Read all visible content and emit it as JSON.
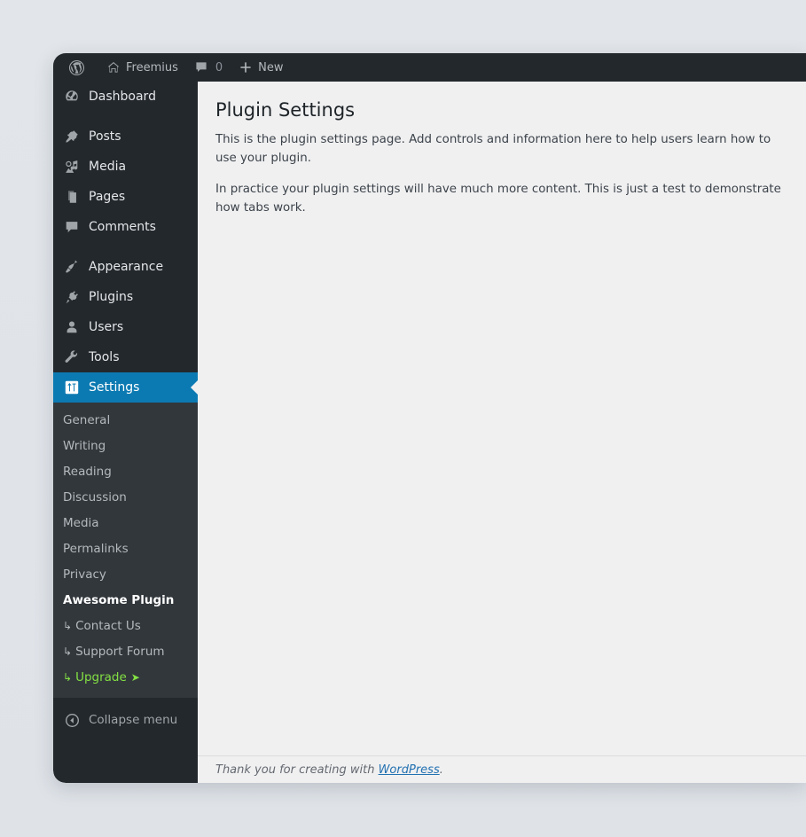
{
  "adminbar": {
    "wp_logo_icon": "wordpress-logo-icon",
    "site_icon": "home-icon",
    "site_name": "Freemius",
    "comments_icon": "comment-bubble-icon",
    "comments_count": "0",
    "new_icon": "plus-icon",
    "new_label": "New"
  },
  "sidebar": {
    "menu": [
      {
        "label": "Dashboard",
        "icon": "dashboard-gauge-icon",
        "current": false,
        "sep_after": true
      },
      {
        "label": "Posts",
        "icon": "pin-icon",
        "current": false,
        "sep_after": false
      },
      {
        "label": "Media",
        "icon": "media-icon",
        "current": false,
        "sep_after": false
      },
      {
        "label": "Pages",
        "icon": "pages-icon",
        "current": false,
        "sep_after": false
      },
      {
        "label": "Comments",
        "icon": "comment-bubble-icon",
        "current": false,
        "sep_after": true
      },
      {
        "label": "Appearance",
        "icon": "paintbrush-icon",
        "current": false,
        "sep_after": false
      },
      {
        "label": "Plugins",
        "icon": "plug-icon",
        "current": false,
        "sep_after": false
      },
      {
        "label": "Users",
        "icon": "user-icon",
        "current": false,
        "sep_after": false
      },
      {
        "label": "Tools",
        "icon": "wrench-icon",
        "current": false,
        "sep_after": false
      },
      {
        "label": "Settings",
        "icon": "settings-sliders-icon",
        "current": true,
        "sep_after": false
      }
    ],
    "submenu": [
      {
        "label": "General",
        "type": "link"
      },
      {
        "label": "Writing",
        "type": "link"
      },
      {
        "label": "Reading",
        "type": "link"
      },
      {
        "label": "Discussion",
        "type": "link"
      },
      {
        "label": "Media",
        "type": "link"
      },
      {
        "label": "Permalinks",
        "type": "link"
      },
      {
        "label": "Privacy",
        "type": "link"
      },
      {
        "label": "Awesome Plugin",
        "type": "head"
      },
      {
        "label": "Contact Us",
        "type": "nested",
        "lead": "↳"
      },
      {
        "label": "Support Forum",
        "type": "nested",
        "lead": "↳"
      },
      {
        "label": "Upgrade",
        "type": "upgrade",
        "lead": "↳",
        "arrow": "➤"
      }
    ],
    "collapse": {
      "label": "Collapse menu",
      "icon": "collapse-arrow-left-icon"
    },
    "colors": {
      "menu_bg": "#23282d",
      "submenu_bg": "#32373c",
      "current_bg": "#0c7ab2",
      "upgrade_green": "#83e043"
    }
  },
  "content": {
    "title": "Plugin Settings",
    "paragraph_1": "This is the plugin settings page. Add controls and information here to help users learn how to use your plugin.",
    "paragraph_2": "In practice your plugin settings will have much more content. This is just a test to demonstrate how tabs work."
  },
  "footer": {
    "prefix": "Thank you for creating with ",
    "link": "WordPress",
    "suffix": "."
  }
}
